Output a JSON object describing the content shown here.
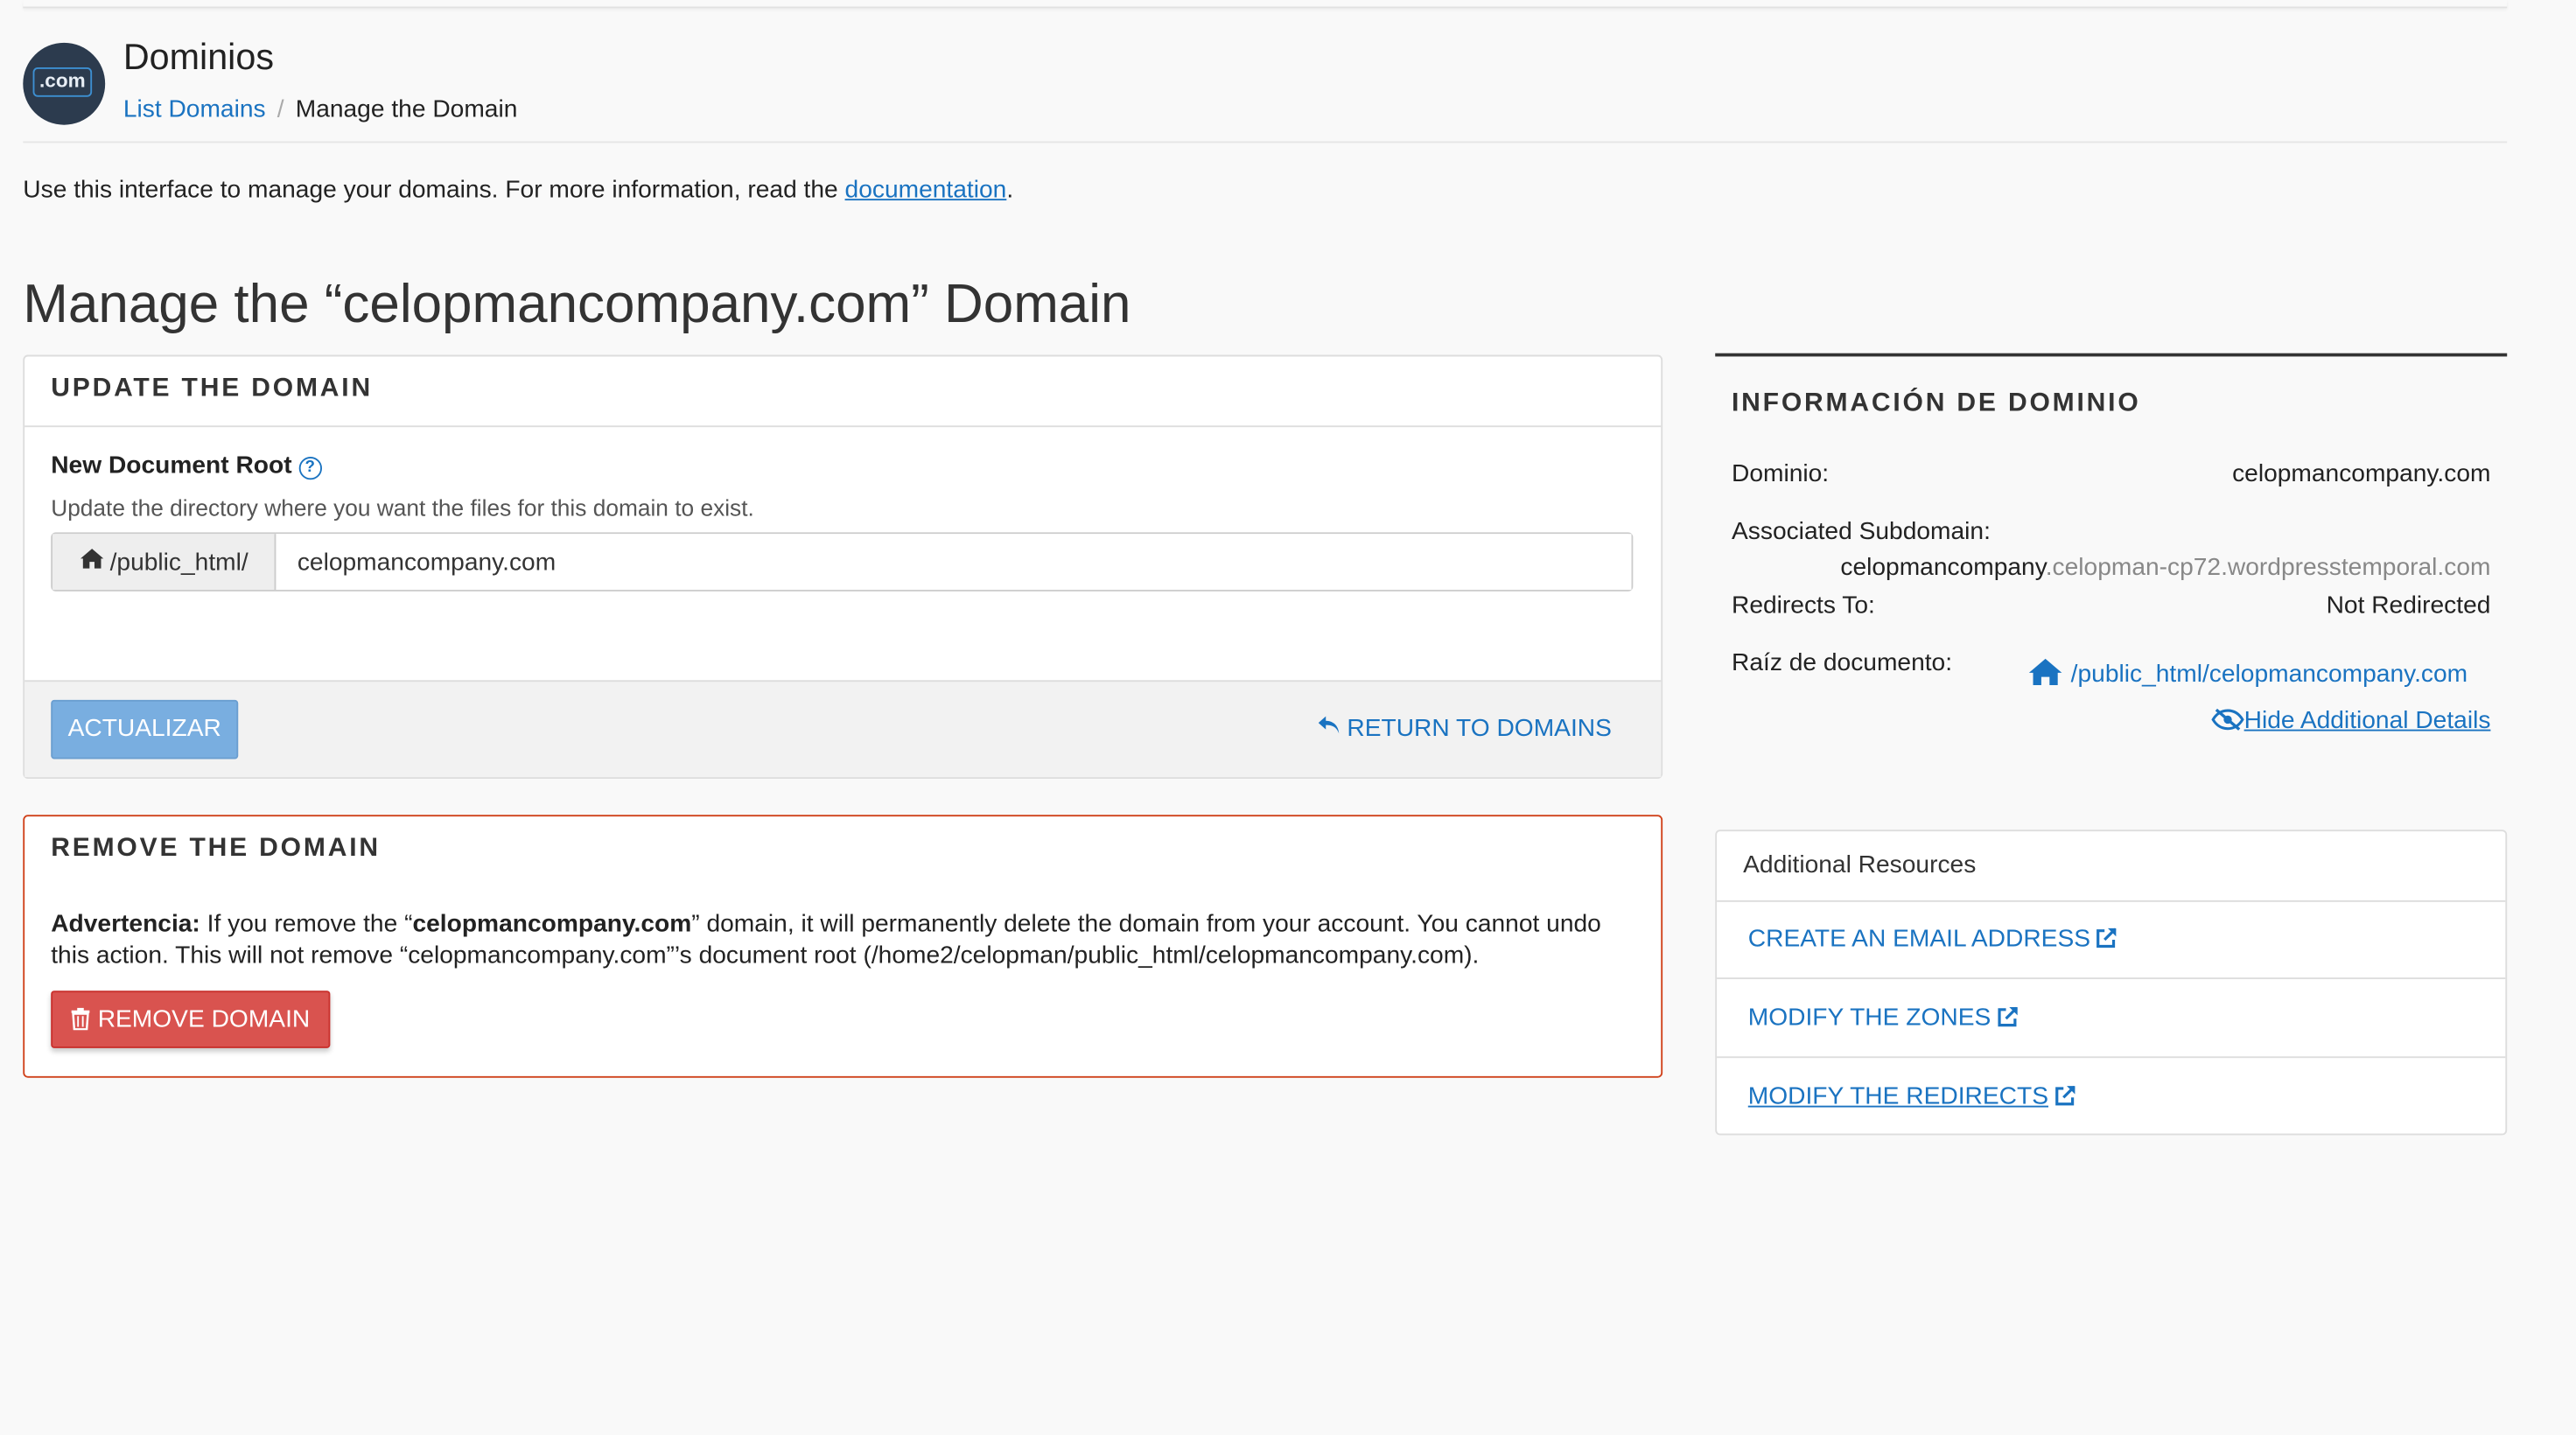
{
  "header": {
    "logo_text": ".com",
    "app_title": "Dominios",
    "breadcrumb": {
      "parent": "List Domains",
      "separator": "/",
      "current": "Manage the Domain"
    }
  },
  "intro": {
    "text": "Use this interface to manage your domains. For more information, read the ",
    "link": "documentation",
    "suffix": "."
  },
  "page_title": "Manage the “celopmancompany.com” Domain",
  "update_panel": {
    "title": "UPDATE THE DOMAIN",
    "field_label": "New Document Root",
    "help_text": "Update the directory where you want the files for this domain to exist.",
    "input_prefix": "/public_html/",
    "input_value": "celopmancompany.com",
    "update_button": "ACTUALIZAR",
    "return_link": "RETURN TO DOMAINS"
  },
  "remove_panel": {
    "title": "REMOVE THE DOMAIN",
    "warning_label": "Advertencia:",
    "warning_pre": " If you remove the “",
    "warning_domain": "celopmancompany.com",
    "warning_post": "” domain, it will permanently delete the domain from your account. You cannot undo this action. This will not remove “celopmancompany.com”’s document root (/home2/celopman/public_html/celopmancompany.com).",
    "remove_button": "REMOVE DOMAIN"
  },
  "domain_info": {
    "title": "INFORMACIÓN DE DOMINIO",
    "domain_label": "Dominio:",
    "domain_value": "celopmancompany.com",
    "subdomain_label": "Associated Subdomain:",
    "subdomain_main": "celopmancompany",
    "subdomain_rest": ".celopman-cp72.wordpresstemporal.com",
    "redirects_label": "Redirects To:",
    "redirects_value": "Not Redirected",
    "docroot_label": "Raíz de documento:",
    "docroot_value": "/public_html/celopmancompany.com",
    "hide_link": "Hide Additional Details"
  },
  "resources": {
    "title": "Additional Resources",
    "items": [
      {
        "label": "CREATE AN EMAIL ADDRESS"
      },
      {
        "label": "MODIFY THE ZONES"
      },
      {
        "label": "MODIFY THE REDIRECTS"
      }
    ]
  },
  "colors": {
    "link": "#1a73c1",
    "danger": "#d9534f",
    "primary_disabled": "#79aee0"
  }
}
